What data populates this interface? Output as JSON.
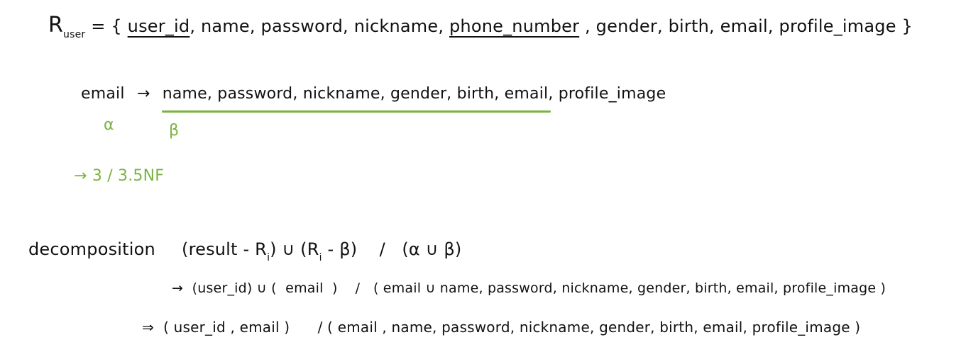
{
  "relation": {
    "name_r": "R",
    "name_sub": "user",
    "prefix": " = {",
    "attr_user_id": "user_id",
    "sep1": ", name, password, nickname, ",
    "attr_phone": "phone_number",
    "rest": " , gender, birth, email, profile_image }"
  },
  "fd": {
    "lhs": "email",
    "arrow": "→",
    "rhs": "name, password, nickname, gender, birth, email, profile_image",
    "alpha": "α",
    "beta": "β"
  },
  "normal_form": "→ 3 / 3.5NF",
  "decomposition": {
    "label": "decomposition",
    "formula": "(result - R",
    "formula_sub1": "i",
    "formula_mid": ") ∪ (R",
    "formula_sub2": "i",
    "formula_end": " - β)    /   (α ∪ β)",
    "step1": "→  (user_id) ∪ (  email  )    /   ( email ∪ name, password, nickname, gender, birth, email, profile_image )",
    "step2": "⇒  ( user_id , email )      / ( email , name, password, nickname, gender, birth, email, profile_image )"
  },
  "colors": {
    "ink": "#111111",
    "green": "#7bb241"
  }
}
